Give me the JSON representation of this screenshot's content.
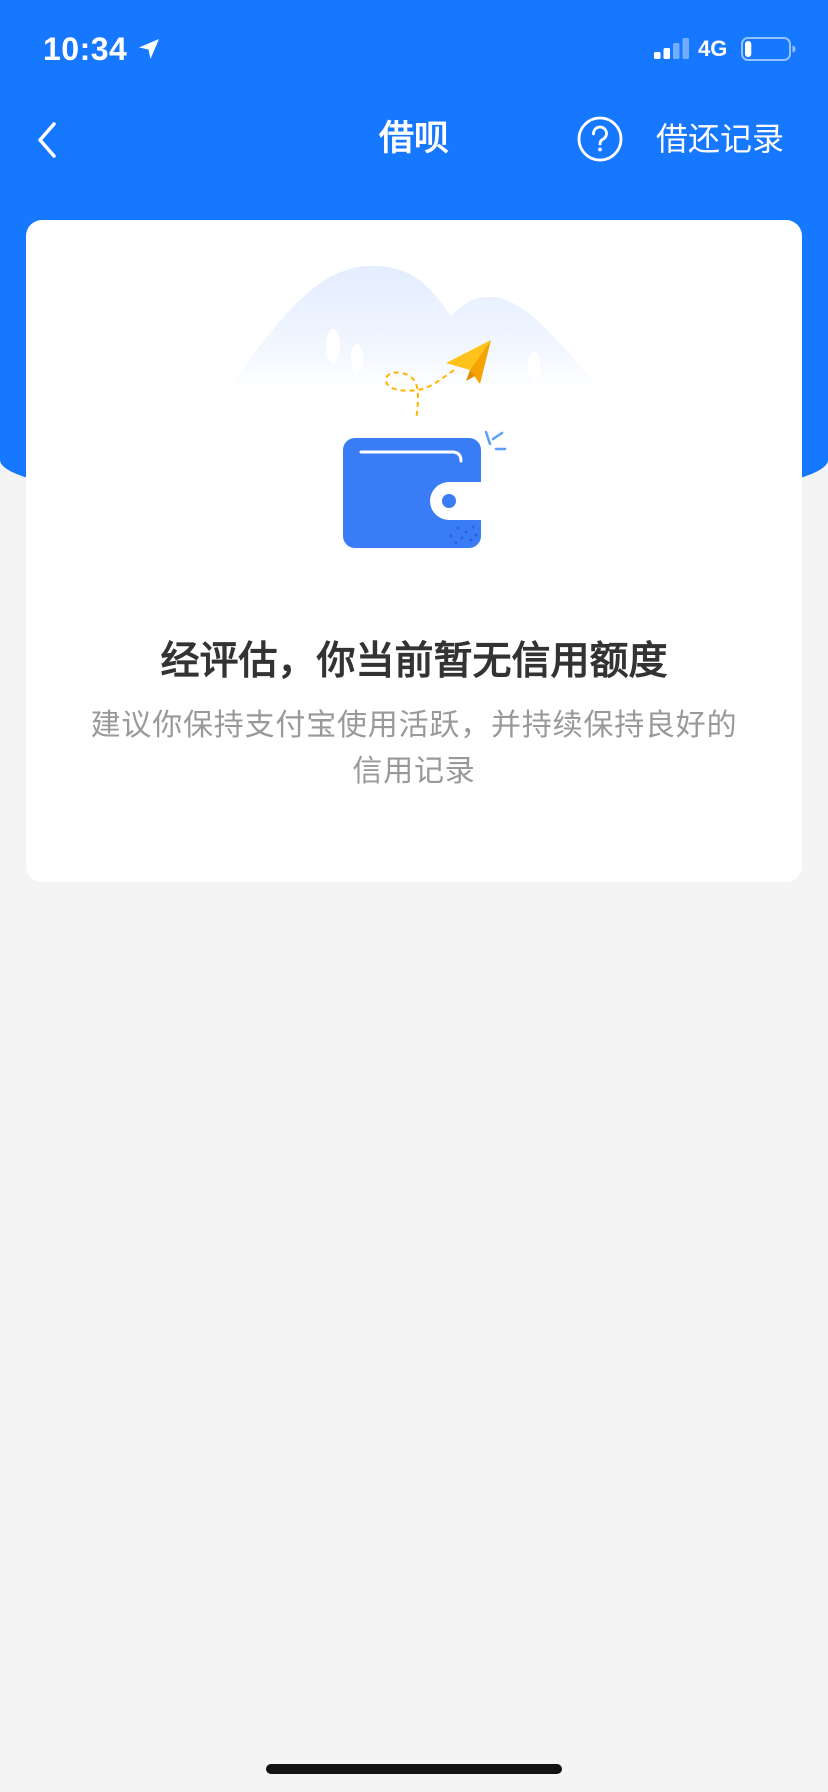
{
  "status_bar": {
    "time": "10:34",
    "network": "4G",
    "signal_level": 2,
    "signal_max": 4,
    "battery_level": 0.15
  },
  "nav": {
    "title": "借呗",
    "records_label": "借还记录"
  },
  "empty_state": {
    "title": "经评估，你当前暂无信用额度",
    "description": "建议你保持支付宝使用活跃，并持续保持良好的信用记录"
  },
  "icons": {
    "status_location": "location-arrow-icon",
    "signal": "cellular-signal-icon",
    "battery": "battery-icon",
    "back": "chevron-left-icon",
    "help": "question-circle-icon",
    "illustration": "empty-wallet-illustration"
  },
  "colors": {
    "brand_blue": "#1677ff",
    "wallet_blue": "#3a7cf6",
    "plane_yellow": "#ffb400",
    "background": "#f4f4f4",
    "title_text": "#333333",
    "description_text": "#999999"
  }
}
